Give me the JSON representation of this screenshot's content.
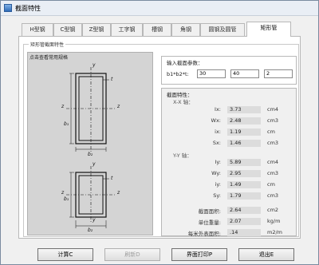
{
  "window": {
    "title": "截面特性"
  },
  "tabs": [
    {
      "label": "H型钢",
      "active": false
    },
    {
      "label": "C型钢",
      "active": false
    },
    {
      "label": "Z型钢",
      "active": false
    },
    {
      "label": "工字钢",
      "active": false
    },
    {
      "label": "槽钢",
      "active": false
    },
    {
      "label": "角钢",
      "active": false
    },
    {
      "label": "圆钢及圆管",
      "active": false
    },
    {
      "label": "矩形管",
      "active": true
    }
  ],
  "group": {
    "title": "矩形管截面特性"
  },
  "diagram": {
    "caption": "点击查看常用规格",
    "labels": {
      "y": "y",
      "z": "z",
      "b1": "b₁",
      "b2": "b₂",
      "t": "t"
    }
  },
  "input": {
    "title": "输入截面参数：",
    "params_label": "b1*b2*t:",
    "b1": "30",
    "b2": "40",
    "t": "2"
  },
  "properties": {
    "title": "截面特性：",
    "xx_label": "X-X 轴：",
    "yy_label": "Y-Y 轴：",
    "rows": [
      {
        "name": "Ix:",
        "value": "3.73",
        "unit": "cm4"
      },
      {
        "name": "Wx:",
        "value": "2.48",
        "unit": "cm3"
      },
      {
        "name": "ix:",
        "value": "1.19",
        "unit": "cm"
      },
      {
        "name": "Sx:",
        "value": "1.46",
        "unit": "cm3"
      },
      {
        "name": "Iy:",
        "value": "5.89",
        "unit": "cm4"
      },
      {
        "name": "Wy:",
        "value": "2.95",
        "unit": "cm3"
      },
      {
        "name": "iy:",
        "value": "1.49",
        "unit": "cm"
      },
      {
        "name": "Sy:",
        "value": "1.79",
        "unit": "cm3"
      },
      {
        "name": "截面面积:",
        "value": "2.64",
        "unit": "cm2"
      },
      {
        "name": "单位重量:",
        "value": "2.07",
        "unit": "kg/m"
      },
      {
        "name": "每米外表面积:",
        "value": ".14",
        "unit": "m2/m"
      }
    ]
  },
  "buttons": {
    "calc": "计算C",
    "ref": "刷新D",
    "print": "界面打印P",
    "exit": "退出E"
  }
}
